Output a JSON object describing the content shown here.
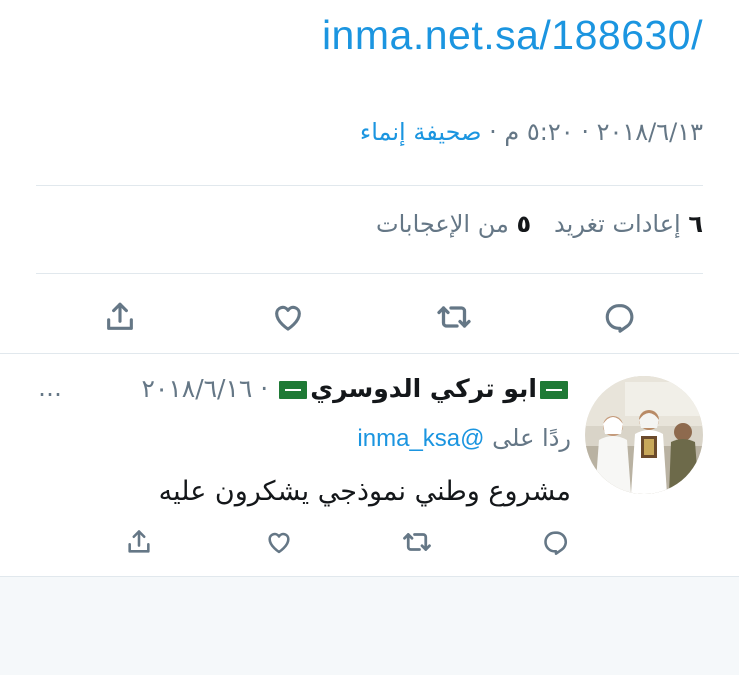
{
  "main_tweet": {
    "link": "inma.net.sa/188630/",
    "date": "٢٠١٨/٦/١٣",
    "time": "٥:٢٠ م",
    "separator": "·",
    "source": "صحيفة إنماء",
    "retweets_count": "٦",
    "retweets_label": "إعادات تغريد",
    "likes_count": "٥",
    "likes_label": "من الإعجابات"
  },
  "reply_tweet": {
    "author_name": "ابو تركي الدوسري",
    "date": "٢٠١٨/٦/١٦",
    "separator": "·",
    "more": "…",
    "replying_to_label": "ردًا على",
    "replying_to_handle": "@inma_ksa",
    "text": "مشروع وطني نموذجي يشكرون عليه"
  },
  "colors": {
    "link": "#1b95e0",
    "secondary_text": "#657786",
    "divider": "#e1e8ed",
    "flag_green": "#1f7a36"
  },
  "icons": [
    "share-icon",
    "like-icon",
    "retweet-icon",
    "reply-icon",
    "flag-icon"
  ]
}
